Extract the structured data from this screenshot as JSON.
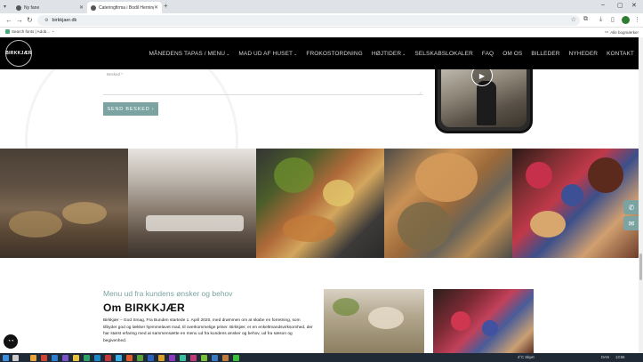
{
  "browser": {
    "tabs": [
      {
        "title": "Ny fane",
        "active": false
      },
      {
        "title": "Cateringfirma i Bodil Herning",
        "active": true
      }
    ],
    "new_tab": "+",
    "url": "birkkjaer.dk",
    "bookmarks": [
      {
        "label": "Search fonts | Adob..."
      }
    ],
    "all_bookmarks": "Alle bogmærker",
    "profile_color": "#2e7d32"
  },
  "site": {
    "logo_text": "BIRKKJÆR",
    "menu": [
      {
        "label": "MÅNEDENS TAPAS / MENU",
        "dropdown": true
      },
      {
        "label": "MAD UD AF HUSET",
        "dropdown": true
      },
      {
        "label": "FROKOSTORDNING",
        "dropdown": false
      },
      {
        "label": "HØJTIDER",
        "dropdown": true
      },
      {
        "label": "SELSKABSLOKALER",
        "dropdown": false
      },
      {
        "label": "FAQ",
        "dropdown": false
      },
      {
        "label": "OM OS",
        "dropdown": false
      },
      {
        "label": "BILLEDER",
        "dropdown": false
      },
      {
        "label": "NYHEDER",
        "dropdown": false
      },
      {
        "label": "KONTAKT",
        "dropdown": false
      }
    ],
    "accent_color": "#7aa3a1"
  },
  "form": {
    "field_label": "Besked *",
    "send_button": "SEND BESKED ›"
  },
  "side_buttons": {
    "phone": "✆",
    "mail": "✉"
  },
  "about": {
    "subtitle": "Menu ud fra kundens ønsker og behov",
    "title": "Om BIRKKJÆR",
    "text": "Birkkjær – God Smag, Fra Bunden startede 1. April 2020, med drømmen om at skabe en forretning, som tilbyder god og lækker hjemmelavet mad, til overkommelige priser. Birkkjær, er en enkeltmandsvirksomhed, der har størst erfaring med at sammensætte en menu ud fra kundens ønsker og behov, ud fra sæson og begivenhed."
  },
  "taskbar": {
    "weather": "4°C Skyet",
    "lang": "DAN",
    "time": "13:56"
  }
}
